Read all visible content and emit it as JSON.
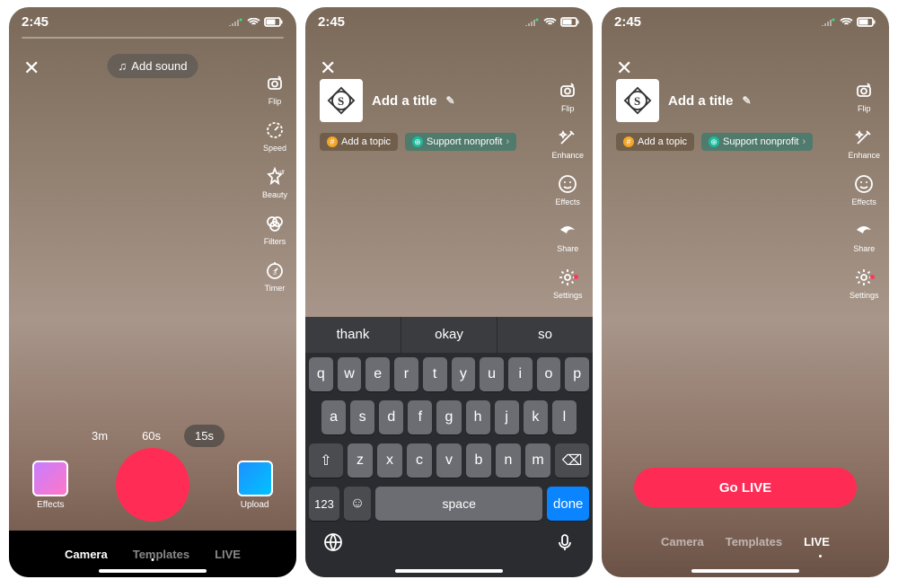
{
  "status": {
    "time": "2:45"
  },
  "screen1": {
    "addSound": "Add sound",
    "tools": {
      "flip": "Flip",
      "speed": "Speed",
      "beauty": "Beauty",
      "filters": "Filters",
      "timer": "Timer"
    },
    "durations": [
      "3m",
      "60s",
      "15s"
    ],
    "durationSelected": "15s",
    "effects": "Effects",
    "upload": "Upload",
    "tabs": [
      "Camera",
      "Templates",
      "LIVE"
    ],
    "tabSelected": "Camera"
  },
  "live": {
    "titlePlaceholder": "Add a title",
    "addTopic": "Add a topic",
    "supportNonprofit": "Support nonprofit",
    "tools": {
      "flip": "Flip",
      "enhance": "Enhance",
      "effects": "Effects",
      "share": "Share",
      "settings": "Settings"
    }
  },
  "keyboard": {
    "suggestions": [
      "thank",
      "okay",
      "so"
    ],
    "row1": [
      "q",
      "w",
      "e",
      "r",
      "t",
      "y",
      "u",
      "i",
      "o",
      "p"
    ],
    "row2": [
      "a",
      "s",
      "d",
      "f",
      "g",
      "h",
      "j",
      "k",
      "l"
    ],
    "row3": [
      "z",
      "x",
      "c",
      "v",
      "b",
      "n",
      "m"
    ],
    "numKey": "123",
    "space": "space",
    "done": "done"
  },
  "screen3": {
    "goLive": "Go LIVE",
    "tabs": [
      "Camera",
      "Templates",
      "LIVE"
    ],
    "tabSelected": "LIVE"
  }
}
